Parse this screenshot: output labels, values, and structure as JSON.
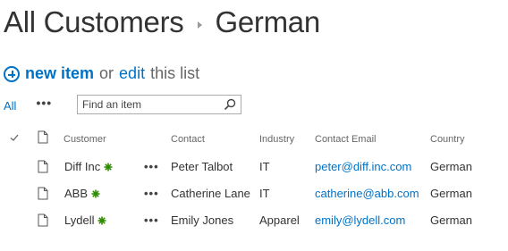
{
  "breadcrumb": {
    "root": "All Customers",
    "current": "German"
  },
  "actions": {
    "new_item": "new item",
    "or_text": "or",
    "edit": "edit",
    "this_list": "this list"
  },
  "views": {
    "all": "All",
    "more": "•••"
  },
  "search": {
    "placeholder": "Find an item"
  },
  "columns": {
    "customer": "Customer",
    "contact": "Contact",
    "industry": "Industry",
    "contact_email": "Contact Email",
    "country": "Country"
  },
  "rows": [
    {
      "customer": "Diff Inc",
      "contact": "Peter Talbot",
      "industry": "IT",
      "email": "peter@diff.inc.com",
      "country": "German"
    },
    {
      "customer": "ABB",
      "contact": "Catherine Lane",
      "industry": "IT",
      "email": "catherine@abb.com",
      "country": "German"
    },
    {
      "customer": "Lydell",
      "contact": "Emily Jones",
      "industry": "Apparel",
      "email": "emily@lydell.com",
      "country": "German"
    }
  ],
  "row_menu": "•••",
  "colors": {
    "link": "#0072c6",
    "new_badge": "#2e8b00",
    "text": "#333333",
    "muted": "#666666"
  },
  "icons": [
    "add-circle-icon",
    "search-icon",
    "checkmark-icon",
    "document-icon",
    "new-item-badge-icon"
  ]
}
